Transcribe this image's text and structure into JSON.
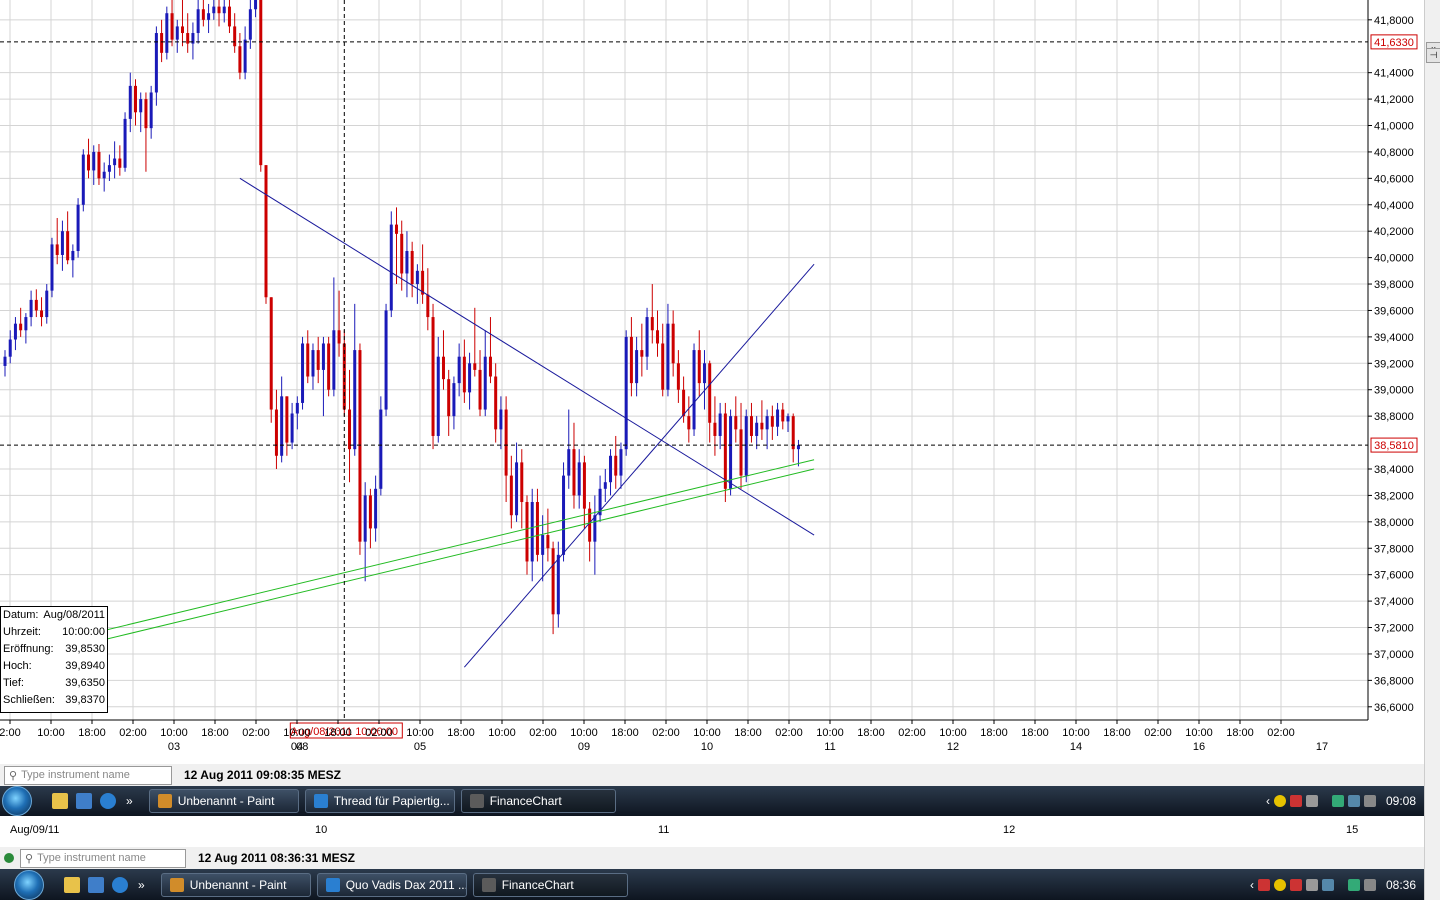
{
  "chart_data": {
    "type": "candlestick",
    "ylim": [
      36.5,
      41.95
    ],
    "y_ticks": [
      "41,8000",
      "41,4000",
      "41,2000",
      "41,0000",
      "40,8000",
      "40,6000",
      "40,4000",
      "40,2000",
      "40,0000",
      "39,8000",
      "39,6000",
      "39,4000",
      "39,2000",
      "39,0000",
      "38,8000",
      "38,4000",
      "38,2000",
      "38,0000",
      "37,8000",
      "37,6000",
      "37,4000",
      "37,2000",
      "37,0000",
      "36,8000",
      "36,6000"
    ],
    "y_tick_values": [
      41.8,
      41.4,
      41.2,
      41.0,
      40.8,
      40.6,
      40.4,
      40.2,
      40.0,
      39.8,
      39.6,
      39.4,
      39.2,
      39.0,
      38.8,
      38.4,
      38.2,
      38.0,
      37.8,
      37.6,
      37.4,
      37.2,
      37.0,
      36.8,
      36.6
    ],
    "price_markers": [
      {
        "label": "41,6330",
        "value": 41.633
      },
      {
        "label": "38,5810",
        "value": 38.581
      }
    ],
    "x_ticks": [
      "2:00",
      "10:00",
      "18:00",
      "02:00",
      "10:00",
      "18:00",
      "02:00",
      "10:00",
      "18:00",
      "02:00",
      "10:00",
      "18:00",
      "10:00",
      "02:00",
      "10:00",
      "18:00",
      "02:00",
      "10:00",
      "18:00",
      "02:00",
      "10:00",
      "18:00",
      "02:00",
      "10:00",
      "18:00",
      "18:00",
      "10:00",
      "18:00",
      "02:00",
      "10:00",
      "18:00",
      "02:00"
    ],
    "x_day_labels": [
      {
        "label": "03",
        "tick": 4
      },
      {
        "label": "04",
        "tick": 7
      },
      {
        "label": "05",
        "tick": 10
      },
      {
        "label": "09",
        "tick": 14
      },
      {
        "label": "10",
        "tick": 17
      },
      {
        "label": "11",
        "tick": 20
      },
      {
        "label": "12",
        "tick": 23
      },
      {
        "label": "14",
        "tick": 26
      },
      {
        "label": "16",
        "tick": 29
      },
      {
        "label": "17",
        "tick": 32
      }
    ],
    "crosshair": {
      "x_label": "Aug/08/2011 10:00:00",
      "day_label": "08"
    },
    "colors": {
      "up": "#1a1ab8",
      "down": "#cc0000",
      "grid": "#d4d4d4",
      "trend_blue": "#1a1a9c",
      "trend_green": "#22bb22",
      "marker": "#cc0000"
    },
    "candles": [
      [
        39.18,
        39.3,
        39.1,
        39.25
      ],
      [
        39.25,
        39.45,
        39.2,
        39.38
      ],
      [
        39.38,
        39.55,
        39.3,
        39.5
      ],
      [
        39.5,
        39.62,
        39.4,
        39.45
      ],
      [
        39.45,
        39.58,
        39.35,
        39.55
      ],
      [
        39.55,
        39.75,
        39.48,
        39.68
      ],
      [
        39.68,
        39.76,
        39.55,
        39.6
      ],
      [
        39.6,
        39.7,
        39.48,
        39.55
      ],
      [
        39.55,
        39.8,
        39.5,
        39.75
      ],
      [
        39.75,
        40.15,
        39.7,
        40.1
      ],
      [
        40.1,
        40.3,
        39.95,
        40.02
      ],
      [
        40.02,
        40.28,
        39.9,
        40.2
      ],
      [
        40.2,
        40.35,
        39.95,
        39.98
      ],
      [
        39.98,
        40.1,
        39.85,
        40.05
      ],
      [
        40.05,
        40.45,
        40.0,
        40.4
      ],
      [
        40.4,
        40.82,
        40.35,
        40.78
      ],
      [
        40.78,
        40.9,
        40.6,
        40.66
      ],
      [
        40.66,
        40.85,
        40.55,
        40.8
      ],
      [
        40.8,
        40.86,
        40.55,
        40.6
      ],
      [
        40.6,
        40.72,
        40.5,
        40.65
      ],
      [
        40.65,
        40.78,
        40.58,
        40.7
      ],
      [
        40.7,
        40.88,
        40.6,
        40.75
      ],
      [
        40.75,
        40.85,
        40.62,
        40.68
      ],
      [
        40.68,
        41.1,
        40.65,
        41.05
      ],
      [
        41.05,
        41.4,
        40.95,
        41.3
      ],
      [
        41.3,
        41.35,
        41.0,
        41.1
      ],
      [
        41.1,
        41.25,
        40.95,
        41.2
      ],
      [
        41.2,
        41.25,
        40.65,
        40.98
      ],
      [
        40.98,
        41.3,
        40.9,
        41.25
      ],
      [
        41.25,
        41.75,
        41.15,
        41.7
      ],
      [
        41.7,
        41.8,
        41.48,
        41.55
      ],
      [
        41.55,
        41.9,
        41.5,
        41.85
      ],
      [
        41.85,
        41.95,
        41.6,
        41.65
      ],
      [
        41.65,
        41.8,
        41.55,
        41.75
      ],
      [
        41.75,
        41.95,
        41.6,
        41.7
      ],
      [
        41.7,
        41.85,
        41.55,
        41.62
      ],
      [
        41.62,
        41.78,
        41.5,
        41.7
      ],
      [
        41.7,
        41.95,
        41.62,
        41.88
      ],
      [
        41.88,
        41.95,
        41.75,
        41.8
      ],
      [
        41.8,
        41.92,
        41.7,
        41.85
      ],
      [
        41.85,
        41.95,
        41.8,
        41.9
      ],
      [
        41.9,
        41.95,
        41.75,
        41.85
      ],
      [
        41.85,
        41.95,
        41.78,
        41.9
      ],
      [
        41.9,
        41.95,
        41.7,
        41.75
      ],
      [
        41.75,
        41.85,
        41.55,
        41.6
      ],
      [
        41.6,
        41.7,
        41.35,
        41.4
      ],
      [
        41.4,
        41.75,
        41.35,
        41.65
      ],
      [
        41.65,
        41.95,
        41.58,
        41.88
      ],
      [
        41.88,
        41.95,
        41.82,
        41.95
      ],
      [
        41.95,
        41.95,
        40.65,
        40.7
      ],
      [
        40.7,
        40.7,
        39.65,
        39.7
      ],
      [
        39.7,
        39.7,
        38.75,
        38.85
      ],
      [
        38.85,
        39.0,
        38.4,
        38.5
      ],
      [
        38.5,
        39.1,
        38.45,
        38.95
      ],
      [
        38.95,
        38.95,
        38.5,
        38.6
      ],
      [
        38.6,
        38.9,
        38.55,
        38.82
      ],
      [
        38.82,
        38.95,
        38.7,
        38.9
      ],
      [
        38.9,
        39.4,
        38.85,
        39.35
      ],
      [
        39.35,
        39.45,
        39.05,
        39.1
      ],
      [
        39.1,
        39.35,
        39.0,
        39.3
      ],
      [
        39.3,
        39.4,
        39.05,
        39.15
      ],
      [
        39.15,
        39.4,
        38.8,
        39.35
      ],
      [
        39.35,
        39.4,
        38.95,
        39.0
      ],
      [
        39.0,
        39.85,
        38.95,
        39.45
      ],
      [
        39.45,
        39.75,
        39.25,
        39.35
      ],
      [
        39.35,
        39.45,
        38.8,
        38.85
      ],
      [
        38.85,
        39.15,
        38.3,
        38.55
      ],
      [
        38.55,
        39.65,
        38.5,
        39.3
      ],
      [
        39.3,
        39.35,
        37.75,
        37.85
      ],
      [
        37.85,
        38.3,
        37.55,
        38.2
      ],
      [
        38.2,
        38.25,
        37.8,
        37.95
      ],
      [
        37.95,
        38.35,
        37.85,
        38.25
      ],
      [
        38.25,
        38.95,
        38.2,
        38.85
      ],
      [
        38.85,
        39.65,
        38.8,
        39.6
      ],
      [
        39.6,
        40.35,
        39.55,
        40.25
      ],
      [
        40.25,
        40.38,
        39.8,
        40.18
      ],
      [
        40.18,
        40.28,
        39.75,
        39.88
      ],
      [
        39.88,
        40.2,
        39.7,
        40.05
      ],
      [
        40.05,
        40.12,
        39.7,
        39.8
      ],
      [
        39.8,
        39.95,
        39.65,
        39.9
      ],
      [
        39.9,
        40.1,
        39.65,
        39.72
      ],
      [
        39.72,
        39.92,
        39.45,
        39.55
      ],
      [
        39.55,
        39.65,
        38.55,
        38.65
      ],
      [
        38.65,
        39.4,
        38.6,
        39.25
      ],
      [
        39.25,
        39.45,
        39.0,
        39.08
      ],
      [
        39.08,
        39.15,
        38.65,
        38.8
      ],
      [
        38.8,
        39.1,
        38.7,
        39.05
      ],
      [
        39.05,
        39.35,
        38.95,
        39.25
      ],
      [
        39.25,
        39.38,
        38.9,
        38.98
      ],
      [
        38.98,
        39.28,
        38.85,
        39.2
      ],
      [
        39.2,
        39.62,
        39.1,
        39.15
      ],
      [
        39.15,
        39.3,
        38.8,
        38.85
      ],
      [
        38.85,
        39.45,
        38.8,
        39.25
      ],
      [
        39.25,
        39.55,
        39.05,
        39.1
      ],
      [
        39.1,
        39.2,
        38.6,
        38.7
      ],
      [
        38.7,
        38.95,
        38.55,
        38.85
      ],
      [
        38.85,
        38.95,
        38.15,
        38.35
      ],
      [
        38.35,
        38.5,
        37.95,
        38.05
      ],
      [
        38.05,
        38.6,
        38.0,
        38.45
      ],
      [
        38.45,
        38.55,
        37.95,
        38.15
      ],
      [
        38.15,
        38.2,
        37.6,
        37.7
      ],
      [
        37.7,
        38.25,
        37.55,
        38.15
      ],
      [
        38.15,
        38.25,
        37.7,
        37.75
      ],
      [
        37.75,
        38.05,
        37.55,
        37.9
      ],
      [
        37.9,
        38.1,
        37.7,
        37.8
      ],
      [
        37.8,
        37.85,
        37.15,
        37.3
      ],
      [
        37.3,
        37.85,
        37.2,
        37.75
      ],
      [
        37.75,
        38.45,
        37.7,
        38.35
      ],
      [
        38.35,
        38.85,
        38.25,
        38.55
      ],
      [
        38.55,
        38.75,
        38.1,
        38.2
      ],
      [
        38.2,
        38.55,
        38.1,
        38.45
      ],
      [
        38.45,
        38.5,
        37.95,
        38.1
      ],
      [
        38.1,
        38.15,
        37.7,
        37.85
      ],
      [
        37.85,
        38.2,
        37.6,
        38.05
      ],
      [
        38.05,
        38.35,
        38.0,
        38.25
      ],
      [
        38.25,
        38.4,
        38.15,
        38.3
      ],
      [
        38.3,
        38.55,
        38.2,
        38.5
      ],
      [
        38.5,
        38.65,
        38.25,
        38.35
      ],
      [
        38.35,
        38.6,
        38.25,
        38.55
      ],
      [
        38.55,
        39.45,
        38.5,
        39.4
      ],
      [
        39.4,
        39.55,
        38.95,
        39.05
      ],
      [
        39.05,
        39.4,
        38.95,
        39.3
      ],
      [
        39.3,
        39.5,
        39.1,
        39.25
      ],
      [
        39.25,
        39.62,
        39.15,
        39.55
      ],
      [
        39.55,
        39.8,
        39.35,
        39.45
      ],
      [
        39.45,
        39.6,
        39.25,
        39.35
      ],
      [
        39.35,
        39.5,
        38.95,
        39.0
      ],
      [
        39.0,
        39.65,
        38.95,
        39.5
      ],
      [
        39.5,
        39.6,
        39.1,
        39.2
      ],
      [
        39.2,
        39.3,
        38.9,
        39.0
      ],
      [
        39.0,
        39.1,
        38.75,
        38.8
      ],
      [
        38.8,
        38.95,
        38.6,
        38.7
      ],
      [
        38.7,
        39.35,
        38.65,
        39.3
      ],
      [
        39.3,
        39.45,
        38.95,
        39.05
      ],
      [
        39.05,
        39.3,
        38.85,
        39.2
      ],
      [
        39.2,
        39.22,
        38.6,
        38.75
      ],
      [
        38.75,
        38.95,
        38.5,
        38.65
      ],
      [
        38.65,
        38.9,
        38.55,
        38.82
      ],
      [
        38.82,
        38.9,
        38.15,
        38.25
      ],
      [
        38.25,
        38.85,
        38.2,
        38.8
      ],
      [
        38.8,
        38.95,
        38.6,
        38.7
      ],
      [
        38.7,
        38.9,
        38.25,
        38.35
      ],
      [
        38.35,
        38.85,
        38.3,
        38.8
      ],
      [
        38.8,
        38.9,
        38.6,
        38.65
      ],
      [
        38.65,
        38.8,
        38.55,
        38.75
      ],
      [
        38.75,
        38.92,
        38.62,
        38.7
      ],
      [
        38.7,
        38.85,
        38.55,
        38.8
      ],
      [
        38.8,
        38.88,
        38.62,
        38.72
      ],
      [
        38.72,
        38.9,
        38.65,
        38.85
      ],
      [
        38.85,
        38.9,
        38.7,
        38.76
      ],
      [
        38.76,
        38.82,
        38.68,
        38.8
      ],
      [
        38.8,
        38.82,
        38.45,
        38.55
      ],
      [
        38.55,
        38.62,
        38.42,
        38.58
      ]
    ],
    "trendlines": [
      {
        "color": "trend_blue",
        "from": [
          45,
          40.6
        ],
        "to": [
          155,
          37.9
        ]
      },
      {
        "color": "trend_blue",
        "from": [
          88,
          36.9
        ],
        "to": [
          155,
          39.95
        ]
      },
      {
        "color": "trend_green",
        "from": [
          -5,
          36.95
        ],
        "to": [
          155,
          38.47
        ]
      },
      {
        "color": "trend_green",
        "from": [
          -5,
          36.88
        ],
        "to": [
          155,
          38.4
        ]
      }
    ],
    "crosshair_index": 65,
    "info_box": {
      "rows": [
        {
          "label": "Datum:",
          "value": "Aug/08/2011"
        },
        {
          "label": "Uhrzeit:",
          "value": "10:00:00"
        },
        {
          "label": "Eröffnung:",
          "value": "39,8530"
        },
        {
          "label": "Hoch:",
          "value": "39,8940"
        },
        {
          "label": "Tief:",
          "value": "39,6350"
        },
        {
          "label": "Schließen:",
          "value": "39,8370"
        }
      ]
    }
  },
  "status_bar": {
    "search_placeholder": "Type instrument name",
    "timestamp": "12 Aug 2011 09:08:35 MESZ"
  },
  "taskbar": {
    "buttons": [
      {
        "label": "Unbenannt - Paint",
        "icon_color": "#d18c2a"
      },
      {
        "label": "Thread für Papiertig...",
        "icon_color": "#2a7fd1"
      },
      {
        "label": "FinanceChart",
        "icon_color": "#5b5b5b"
      }
    ],
    "time": "09:08"
  },
  "ghost_chart": {
    "first_tick": "Aug/09/11",
    "day_labels": [
      "10",
      "11",
      "12",
      "15"
    ],
    "search_placeholder": "Type instrument name",
    "timestamp": "12 Aug 2011 08:36:31 MESZ"
  },
  "taskbar2": {
    "buttons": [
      {
        "label": "Unbenannt - Paint",
        "icon_color": "#d18c2a"
      },
      {
        "label": "Quo Vadis Dax 2011 ...",
        "icon_color": "#2a7fd1"
      },
      {
        "label": "FinanceChart",
        "icon_color": "#5b5b5b"
      }
    ],
    "time": "08:36"
  }
}
